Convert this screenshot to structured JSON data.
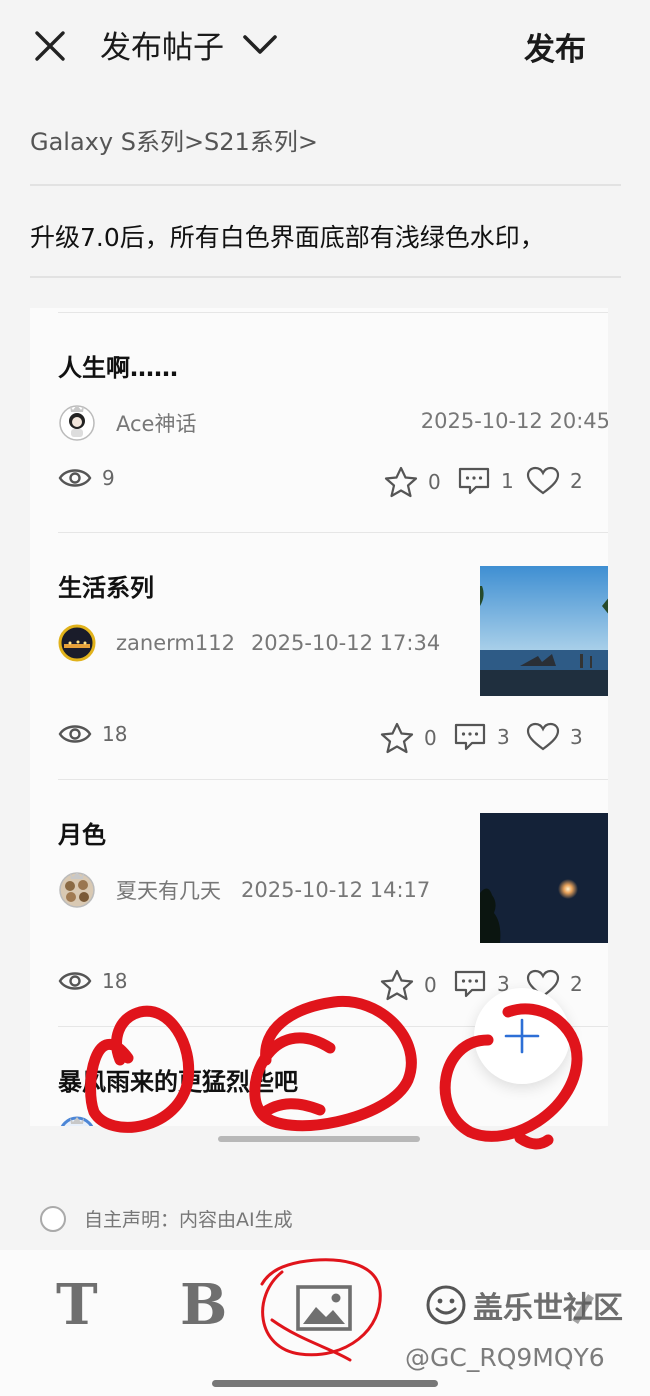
{
  "header": {
    "title": "发布帖子",
    "publish_label": "发布"
  },
  "breadcrumb": "Galaxy S系列>S21系列>",
  "post_title": "升级7.0后，所有白色界面底部有浅绿色水印，",
  "posts": [
    {
      "title": "人生啊……",
      "author": "Ace神话",
      "date": "2025-10-12 20:45",
      "views": "9",
      "stars": "0",
      "comments": "1",
      "likes": "2",
      "has_image": false
    },
    {
      "title": "生活系列",
      "author": "zanerm112",
      "date": "2025-10-12 17:34",
      "views": "18",
      "stars": "0",
      "comments": "3",
      "likes": "3",
      "has_image": true,
      "image_icon": "seaside-photo"
    },
    {
      "title": "月色",
      "author": "夏天有几天",
      "date": "2025-10-12 14:17",
      "views": "18",
      "stars": "0",
      "comments": "3",
      "likes": "2",
      "has_image": true,
      "image_icon": "night-moon-photo"
    },
    {
      "title": "暴风雨来的更猛烈些吧"
    }
  ],
  "disclaimer": "自主声明：内容由AI生成",
  "toolbar": {
    "text_label": "T",
    "bold_label": "B",
    "image_icon": "image-icon"
  },
  "watermark": {
    "brand": "盖乐世社区",
    "user_id": "@GC_RQ9MQY6"
  },
  "colors": {
    "annotation": "#e0141b",
    "fab_plus": "#2d6fd6",
    "background": "#f4f4f4"
  }
}
